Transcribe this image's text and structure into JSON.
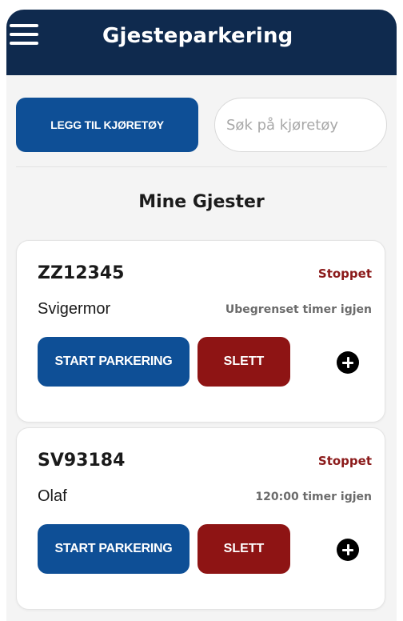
{
  "header": {
    "title": "Gjesteparkering",
    "menu_icon": "hamburger-menu-icon"
  },
  "toolbar": {
    "add_vehicle_label": "LEGG TIL KJØRETØY",
    "search_placeholder": "Søk på kjøretøy"
  },
  "section": {
    "title": "Mine Gjester"
  },
  "guests": [
    {
      "plate": "ZZ12345",
      "status": "Stoppet",
      "name": "Svigermor",
      "remaining": "Ubegrenset timer igjen",
      "start_label": "START PARKERING",
      "delete_label": "SLETT",
      "more_icon": "plus-circle-icon"
    },
    {
      "plate": "SV93184",
      "status": "Stoppet",
      "name": "Olaf",
      "remaining": "120:00 timer igjen",
      "start_label": "START PARKERING",
      "delete_label": "SLETT",
      "more_icon": "plus-circle-icon"
    }
  ],
  "colors": {
    "header_bg": "#0f2a4e",
    "primary": "#0e4f96",
    "danger": "#8e1414",
    "status_stopped": "#8b1a1a"
  }
}
